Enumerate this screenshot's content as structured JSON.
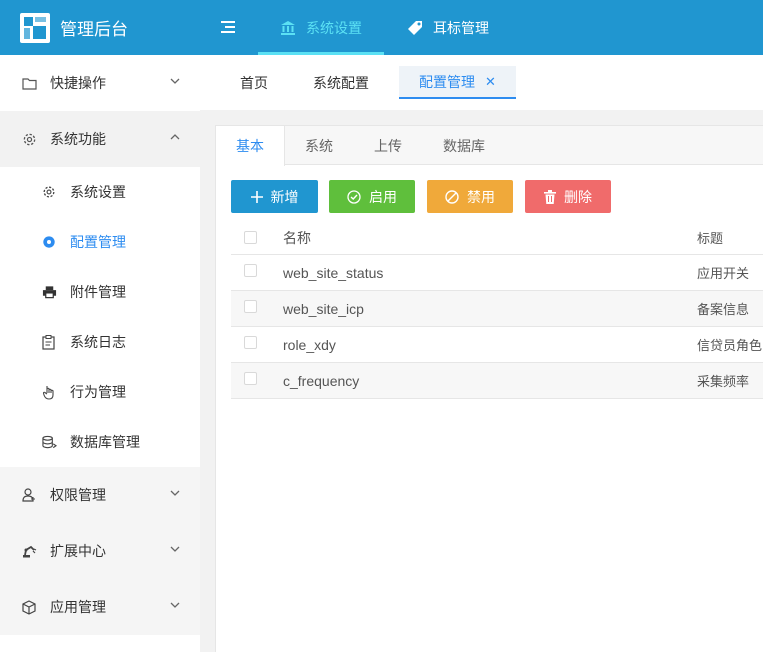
{
  "app": {
    "title": "管理后台"
  },
  "topnav": {
    "items": [
      {
        "label": "系统设置",
        "icon": "bank-icon",
        "active": true
      },
      {
        "label": "耳标管理",
        "icon": "tag-icon",
        "active": false
      }
    ]
  },
  "sidebar": {
    "groups": [
      {
        "label": "快捷操作",
        "icon": "folder-icon",
        "expanded": false
      },
      {
        "label": "系统功能",
        "icon": "gear-icon",
        "expanded": true
      },
      {
        "label": "权限管理",
        "icon": "user-icon",
        "expanded": false
      },
      {
        "label": "扩展中心",
        "icon": "robot-arm-icon",
        "expanded": false
      },
      {
        "label": "应用管理",
        "icon": "cube-icon",
        "expanded": false
      }
    ],
    "sub": [
      {
        "label": "系统设置",
        "icon": "gear-icon"
      },
      {
        "label": "配置管理",
        "icon": "gear-filled-icon",
        "active": true
      },
      {
        "label": "附件管理",
        "icon": "printer-icon"
      },
      {
        "label": "系统日志",
        "icon": "clipboard-icon"
      },
      {
        "label": "行为管理",
        "icon": "pointer-hand-icon"
      },
      {
        "label": "数据库管理",
        "icon": "database-icon"
      }
    ]
  },
  "tabs": [
    {
      "label": "首页"
    },
    {
      "label": "系统配置"
    },
    {
      "label": "配置管理",
      "active": true,
      "close": "✕"
    }
  ],
  "subtabs": [
    "基本",
    "系统",
    "上传",
    "数据库"
  ],
  "toolbar": {
    "add": "新增",
    "enable": "启用",
    "disable": "禁用",
    "delete": "删除"
  },
  "table": {
    "columns": [
      "名称",
      "标题"
    ],
    "rows": [
      {
        "name": "web_site_status",
        "title": "应用开关"
      },
      {
        "name": "web_site_icp",
        "title": "备案信息"
      },
      {
        "name": "role_xdy",
        "title": "信贷员角色"
      },
      {
        "name": "c_frequency",
        "title": "采集频率"
      }
    ]
  },
  "colors": {
    "header": "#2096d0",
    "accent": "#5be1f4",
    "primary": "#2d8cf0",
    "add": "#2096d0",
    "enable": "#5fbf3c",
    "disable": "#f0a93a",
    "delete": "#f06b6b"
  }
}
